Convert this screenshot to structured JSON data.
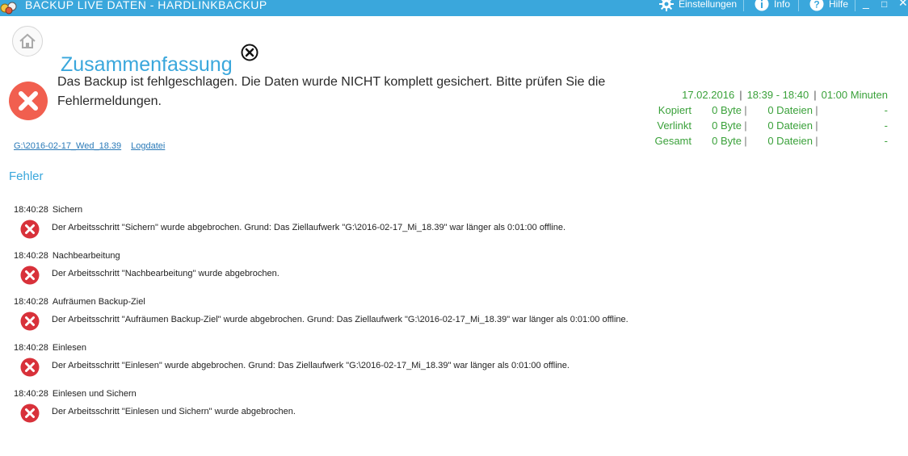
{
  "window": {
    "title": "BACKUP LIVE DATEN - HARDLINKBACKUP",
    "settings_label": "Einstellungen",
    "info_label": "Info",
    "help_label": "Hilfe",
    "minimize_label": "_",
    "maximize_label": "□",
    "close_label": "✕",
    "accent_color": "#3aa7dc"
  },
  "header": {
    "title": "Zusammenfassung",
    "home_icon": "home-icon",
    "close_icon": "close-circle-icon"
  },
  "status": {
    "message": "Das Backup ist fehlgeschlagen. Die Daten wurde NICHT komplett gesichert. Bitte prüfen Sie die Fehlermeldungen.",
    "icon": "error-icon",
    "color": "#f15f4f"
  },
  "links": {
    "backup_folder": "G:\\2016-02-17_Wed_18.39",
    "logfile": "Logdatei"
  },
  "stats": {
    "date": "17.02.2016",
    "time_range": "18:39 - 18:40",
    "duration": "01:00 Minuten",
    "color": "#3aa13a",
    "rows": [
      {
        "label": "Kopiert",
        "size": "0 Byte",
        "files": "0 Dateien",
        "extra": "-"
      },
      {
        "label": "Verlinkt",
        "size": "0 Byte",
        "files": "0 Dateien",
        "extra": "-"
      },
      {
        "label": "Gesamt",
        "size": "0 Byte",
        "files": "0 Dateien",
        "extra": "-"
      }
    ]
  },
  "errors": {
    "section_title": "Fehler",
    "items": [
      {
        "time": "18:40:28",
        "step": "Sichern",
        "message": "Der Arbeitsschritt \"Sichern\" wurde abgebrochen. Grund: Das Ziellaufwerk \"G:\\2016-02-17_Mi_18.39\" war länger als 0:01:00 offline."
      },
      {
        "time": "18:40:28",
        "step": "Nachbearbeitung",
        "message": "Der Arbeitsschritt \"Nachbearbeitung\" wurde abgebrochen."
      },
      {
        "time": "18:40:28",
        "step": "Aufräumen Backup-Ziel",
        "message": "Der Arbeitsschritt \"Aufräumen Backup-Ziel\" wurde abgebrochen. Grund: Das Ziellaufwerk \"G:\\2016-02-17_Mi_18.39\" war länger als 0:01:00 offline."
      },
      {
        "time": "18:40:28",
        "step": "Einlesen",
        "message": "Der Arbeitsschritt \"Einlesen\" wurde abgebrochen. Grund: Das Ziellaufwerk \"G:\\2016-02-17_Mi_18.39\" war länger als 0:01:00 offline."
      },
      {
        "time": "18:40:28",
        "step": "Einlesen und Sichern",
        "message": "Der Arbeitsschritt \"Einlesen und Sichern\" wurde abgebrochen."
      }
    ]
  }
}
